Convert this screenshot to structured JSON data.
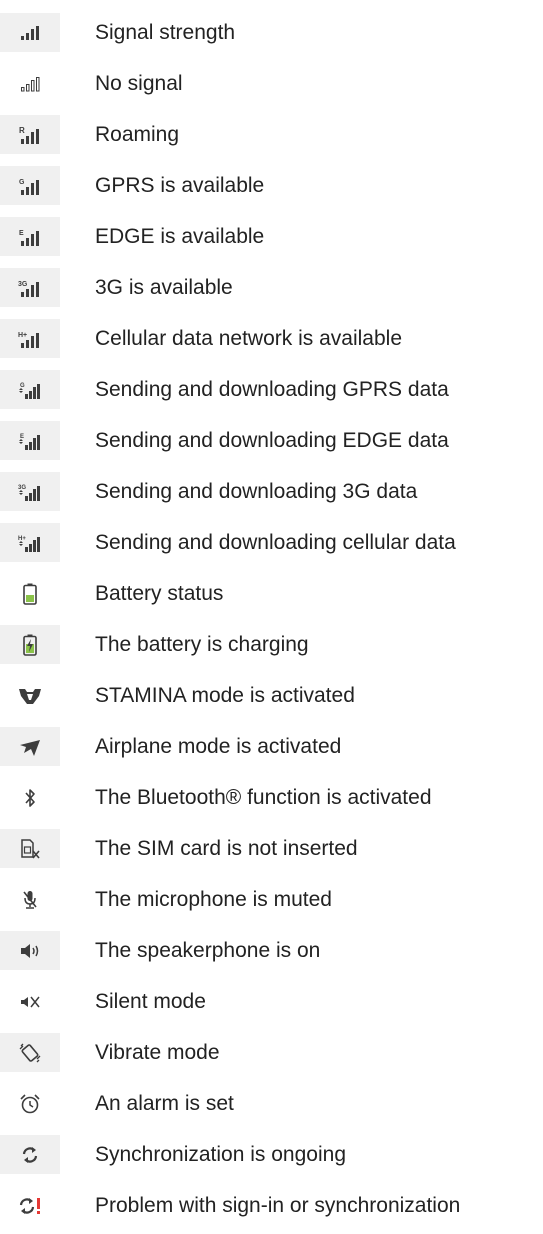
{
  "colors": {
    "icon": "#3d3d3d",
    "icon_light": "#8a8a8a",
    "icon_bg": "#f0f0f0",
    "battery_green": "#8bc34a",
    "alert_red": "#e53935"
  },
  "items": [
    {
      "icon": "signal-strength-icon",
      "label": "Signal strength"
    },
    {
      "icon": "no-signal-icon",
      "label": "No signal"
    },
    {
      "icon": "roaming-icon",
      "label": "Roaming"
    },
    {
      "icon": "gprs-icon",
      "label": "GPRS is available"
    },
    {
      "icon": "edge-icon",
      "label": "EDGE is available"
    },
    {
      "icon": "3g-icon",
      "label": "3G is available"
    },
    {
      "icon": "cellular-data-icon",
      "label": "Cellular data network is available"
    },
    {
      "icon": "gprs-transfer-icon",
      "label": "Sending and downloading GPRS data"
    },
    {
      "icon": "edge-transfer-icon",
      "label": "Sending and downloading EDGE data"
    },
    {
      "icon": "3g-transfer-icon",
      "label": "Sending and downloading 3G data"
    },
    {
      "icon": "cellular-transfer-icon",
      "label": "Sending and downloading cellular data"
    },
    {
      "icon": "battery-icon",
      "label": "Battery status"
    },
    {
      "icon": "battery-charging-icon",
      "label": "The battery is charging"
    },
    {
      "icon": "stamina-icon",
      "label": "STAMINA mode is activated"
    },
    {
      "icon": "airplane-icon",
      "label": "Airplane mode is activated"
    },
    {
      "icon": "bluetooth-icon",
      "label": "The Bluetooth® function is activated"
    },
    {
      "icon": "no-sim-icon",
      "label": "The SIM card is not inserted"
    },
    {
      "icon": "mic-muted-icon",
      "label": "The microphone is muted"
    },
    {
      "icon": "speakerphone-icon",
      "label": "The speakerphone is on"
    },
    {
      "icon": "silent-icon",
      "label": "Silent mode"
    },
    {
      "icon": "vibrate-icon",
      "label": "Vibrate mode"
    },
    {
      "icon": "alarm-icon",
      "label": "An alarm is set"
    },
    {
      "icon": "sync-icon",
      "label": "Synchronization is ongoing"
    },
    {
      "icon": "sync-problem-icon",
      "label": "Problem with sign-in or synchronization"
    }
  ]
}
